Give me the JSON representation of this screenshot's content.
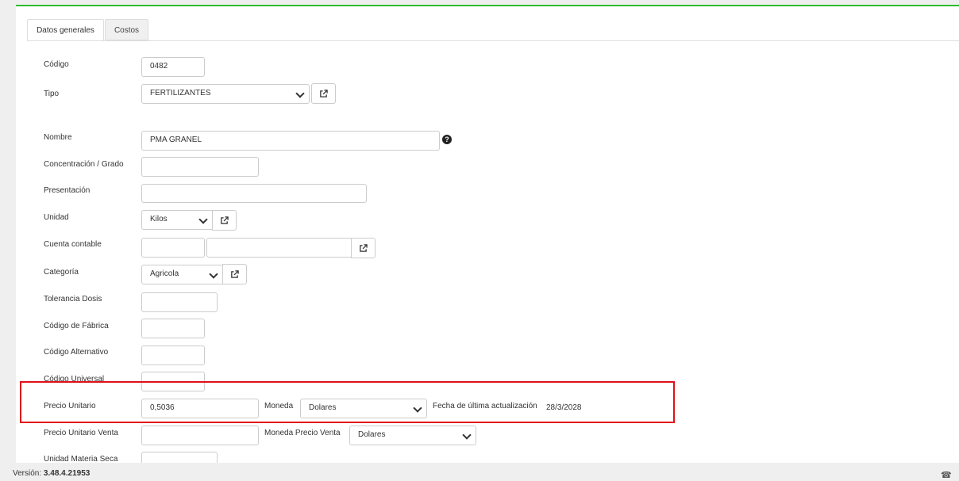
{
  "tabs": [
    {
      "label": "Datos generales",
      "active": true
    },
    {
      "label": "Costos",
      "active": false
    }
  ],
  "form": {
    "codigo": {
      "label": "Código",
      "value": "0482"
    },
    "tipo": {
      "label": "Tipo",
      "value": "FERTILIZANTES"
    },
    "nombre": {
      "label": "Nombre",
      "value": "PMA GRANEL"
    },
    "concentracion": {
      "label": "Concentración / Grado",
      "value": ""
    },
    "presentacion": {
      "label": "Presentación",
      "value": ""
    },
    "unidad": {
      "label": "Unidad",
      "value": "Kilos"
    },
    "cuenta_contable": {
      "label": "Cuenta contable",
      "value1": "",
      "value2": ""
    },
    "categoria": {
      "label": "Categoría",
      "value": "Agricola"
    },
    "tolerancia_dosis": {
      "label": "Tolerancia Dosis",
      "value": ""
    },
    "codigo_fabrica": {
      "label": "Código de Fábrica",
      "value": ""
    },
    "codigo_alternativo": {
      "label": "Código Alternativo",
      "value": ""
    },
    "codigo_universal": {
      "label": "Código Universal",
      "value": ""
    },
    "precio_unitario": {
      "label": "Precio Unitario",
      "value": "0,5036"
    },
    "moneda": {
      "label": "Moneda",
      "value": "Dolares"
    },
    "fecha_actualizacion": {
      "label": "Fecha de última actualización",
      "value": "28/3/2028"
    },
    "precio_unitario_venta": {
      "label": "Precio Unitario Venta",
      "value": ""
    },
    "moneda_precio_venta": {
      "label": "Moneda Precio Venta",
      "value": "Dolares"
    },
    "unidad_materia_seca": {
      "label": "Unidad Materia Seca",
      "value": ""
    }
  },
  "icons": {
    "external_link": "external-link-icon",
    "help": "question-circle-icon",
    "dropdown": "chevron-down-icon"
  },
  "colors": {
    "accent_top_border": "#2ebd2e",
    "highlight_box": "#e0101a"
  },
  "footer": {
    "version_label": "Versión:",
    "version_value": "3.48.4.21953"
  }
}
